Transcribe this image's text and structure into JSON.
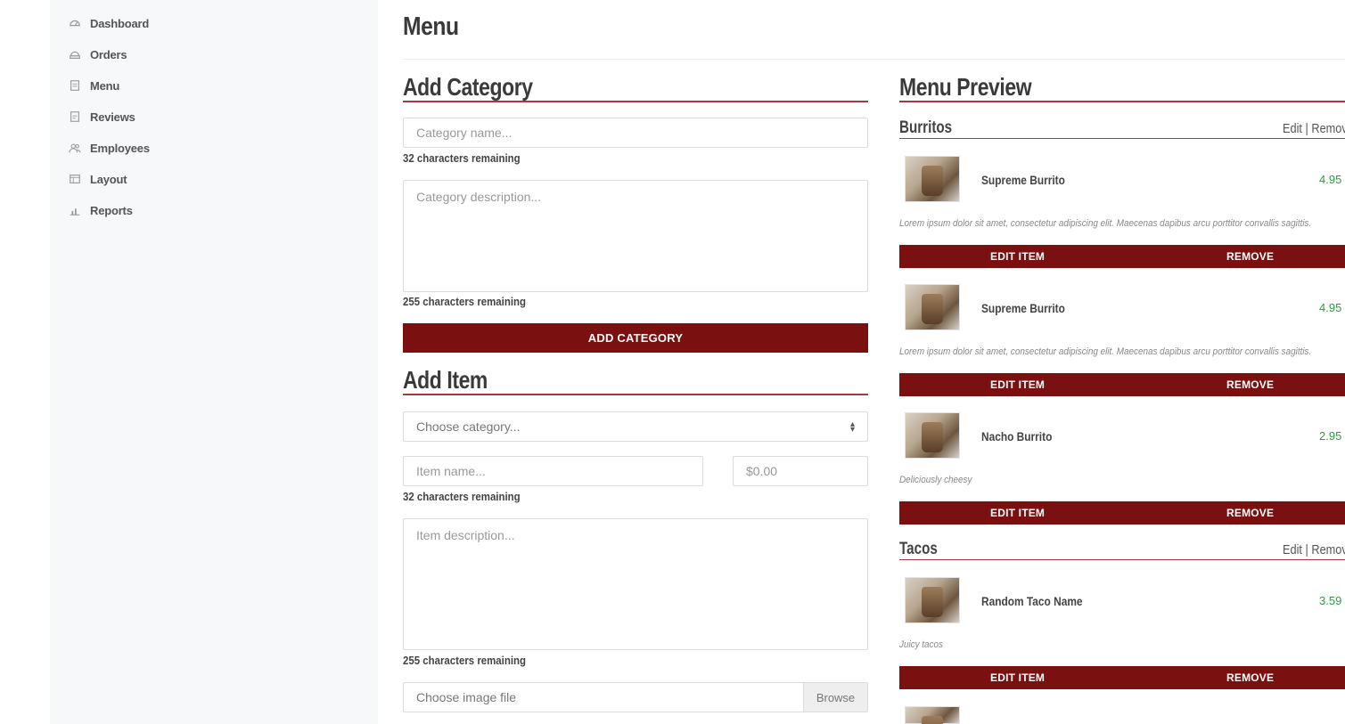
{
  "sidebar": {
    "items": [
      {
        "label": "Dashboard",
        "icon": "dashboard-icon"
      },
      {
        "label": "Orders",
        "icon": "orders-icon"
      },
      {
        "label": "Menu",
        "icon": "menu-icon"
      },
      {
        "label": "Reviews",
        "icon": "reviews-icon"
      },
      {
        "label": "Employees",
        "icon": "employees-icon"
      },
      {
        "label": "Layout",
        "icon": "layout-icon"
      },
      {
        "label": "Reports",
        "icon": "reports-icon"
      }
    ]
  },
  "page": {
    "title": "Menu"
  },
  "add_category": {
    "heading": "Add Category",
    "name_placeholder": "Category name...",
    "name_hint": "32 characters remaining",
    "desc_placeholder": "Category description...",
    "desc_hint": "255 characters remaining",
    "button": "ADD CATEGORY"
  },
  "add_item": {
    "heading": "Add Item",
    "category_select": "Choose category...",
    "name_placeholder": "Item name...",
    "price_placeholder": "$0.00",
    "name_hint": "32 characters remaining",
    "desc_placeholder": "Item description...",
    "desc_hint": "255 characters remaining",
    "image_placeholder": "Choose image file",
    "browse": "Browse"
  },
  "preview": {
    "heading": "Menu Preview",
    "edit_remove": "Edit | Remove",
    "edit_item": "EDIT ITEM",
    "remove": "REMOVE",
    "categories": [
      {
        "name": "Burritos",
        "items": [
          {
            "name": "Supreme Burrito",
            "price": "4.95",
            "desc": "Lorem ipsum dolor sit amet, consectetur adipiscing elit. Maecenas dapibus arcu porttitor convallis sagittis."
          },
          {
            "name": "Supreme Burrito",
            "price": "4.95",
            "desc": "Lorem ipsum dolor sit amet, consectetur adipiscing elit. Maecenas dapibus arcu porttitor convallis sagittis."
          },
          {
            "name": "Nacho Burrito",
            "price": "2.95",
            "desc": "Deliciously cheesy"
          }
        ]
      },
      {
        "name": "Tacos",
        "items": [
          {
            "name": "Random Taco Name",
            "price": "3.59",
            "desc": "Juicy tacos"
          }
        ]
      }
    ]
  },
  "colors": {
    "accent": "#7a1010",
    "rule": "#a8383c",
    "price": "#2a9d3a"
  }
}
